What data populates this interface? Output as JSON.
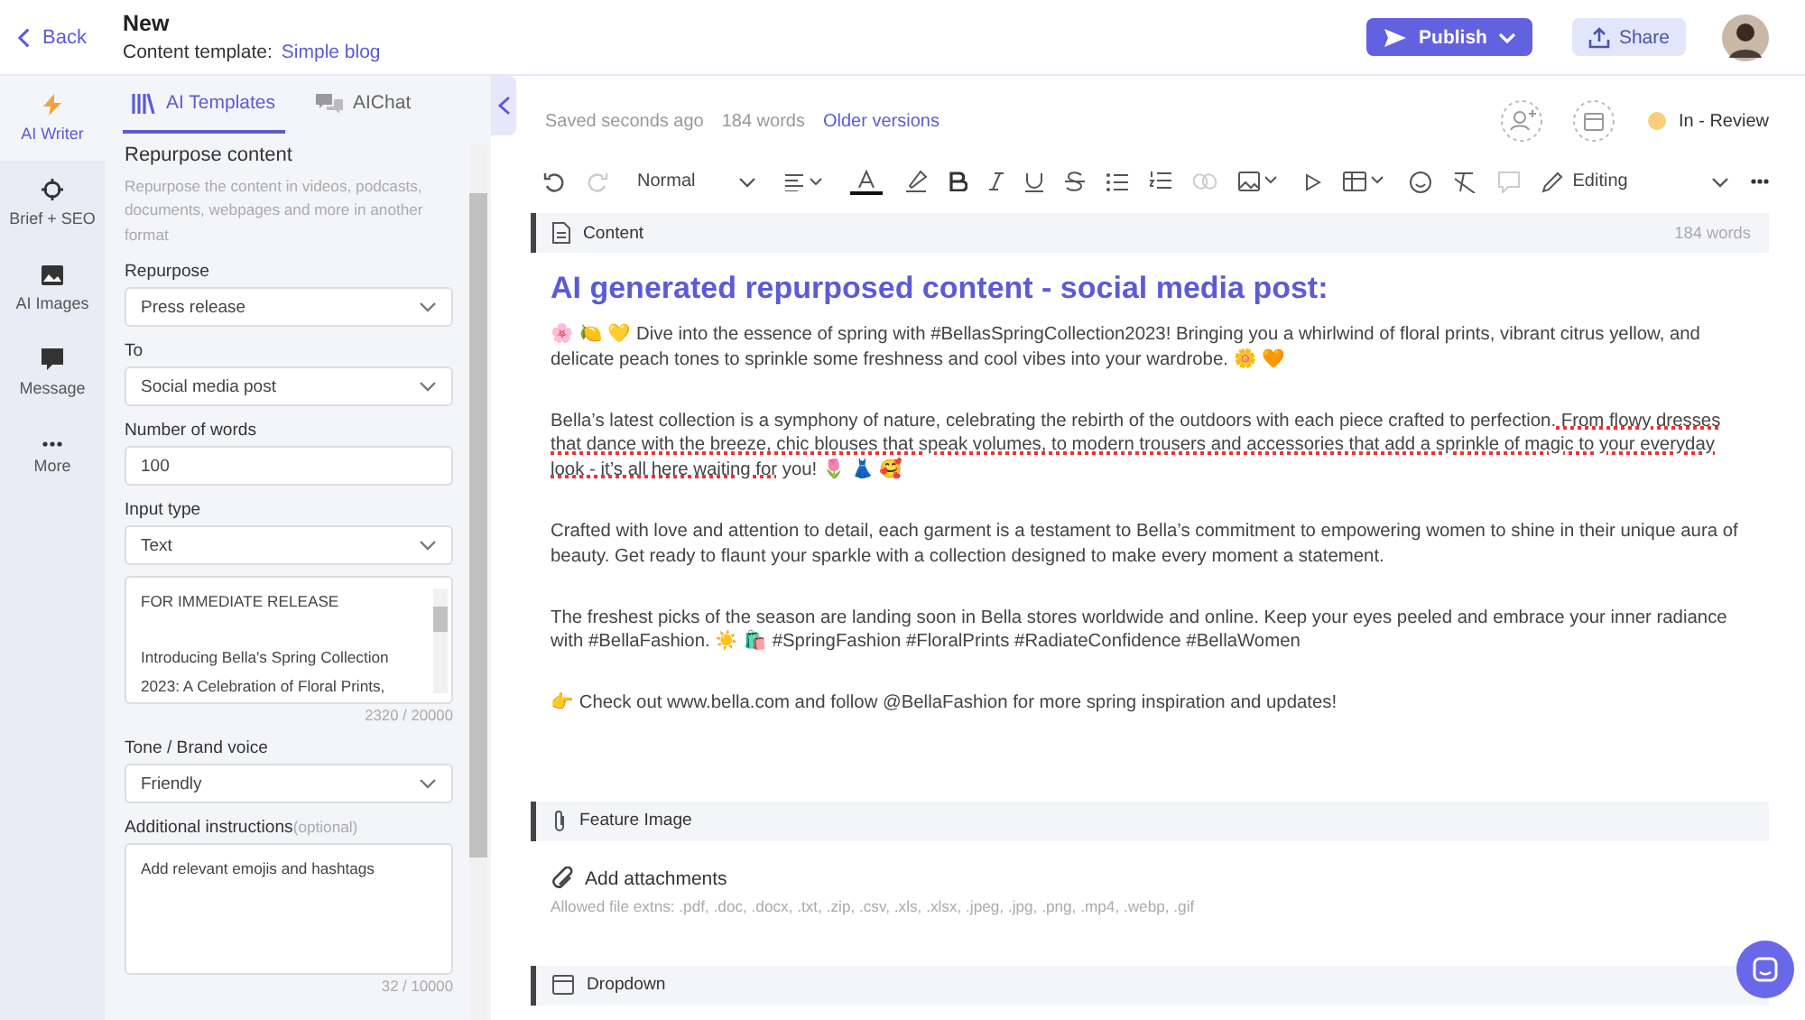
{
  "header": {
    "back": "Back",
    "title": "New",
    "template_label": "Content template:",
    "template_link": "Simple blog",
    "publish": "Publish",
    "share": "Share"
  },
  "rail": [
    {
      "label": "AI Writer",
      "selected": true
    },
    {
      "label": "Brief + SEO",
      "selected": false
    },
    {
      "label": "AI Images",
      "selected": false
    },
    {
      "label": "Message",
      "selected": false
    },
    {
      "label": "More",
      "selected": false
    }
  ],
  "panel_tabs": [
    {
      "label": "AI Templates",
      "selected": true
    },
    {
      "label": "AIChat",
      "selected": false
    }
  ],
  "form": {
    "heading": "Repurpose content",
    "description": "Repurpose the content in videos, podcasts, documents, webpages and more in another format",
    "fields": [
      {
        "kind": "select",
        "label": "Repurpose",
        "value": "Press release"
      },
      {
        "kind": "select",
        "label": "To",
        "value": "Social media post"
      },
      {
        "kind": "input",
        "label": "Number of words",
        "value": "100"
      },
      {
        "kind": "select",
        "label": "Input type",
        "value": "Text"
      },
      {
        "kind": "textarea",
        "lines": [
          "FOR IMMEDIATE RELEASE",
          "Introducing Bella's Spring Collection 2023: A Celebration of Floral Prints,"
        ],
        "counter": "2320 / 20000"
      },
      {
        "kind": "select",
        "label": "Tone / Brand voice",
        "value": "Friendly"
      },
      {
        "kind": "textarea",
        "label": "Additional instructions",
        "hint": "(optional)",
        "lines": [
          "Add relevant emojis and hashtags"
        ],
        "counter": "32 / 10000"
      }
    ]
  },
  "status": {
    "saved": "Saved seconds ago",
    "words": "184 words",
    "older_versions": "Older versions",
    "state": "In - Review",
    "color": "#f9cf7c"
  },
  "toolbar": {
    "style": "Normal",
    "mode": "Editing"
  },
  "content": {
    "title": "Content",
    "count": "184 words",
    "heading": "AI generated repurposed content - social media post:",
    "paragraphs": [
      [
        {
          "text": "🌸 🍋 💛 Dive into the essence of spring with #BellasSpringCollection2023! Bringing you a whirlwind of floral prints, vibrant citrus yellow, and delicate peach tones to sprinkle some freshness and cool vibes into your wardrobe. 🌼 🧡",
          "flagged": false
        }
      ],
      [
        {
          "text": "Bella’s latest collection is a symphony of nature, celebrating the rebirth of the outdoors with each piece crafted to perfection.",
          "flagged": false
        },
        {
          "text": " From flowy dresses that dance with the breeze, chic blouses that speak volumes, to modern trousers and accessories that add a sprinkle of magic to your everyday look - it’s all here waiting for",
          "flagged": true
        },
        {
          "text": " you! 🌷 👗 🥰",
          "flagged": false
        }
      ],
      [
        {
          "text": "Crafted with love and attention to detail, each garment is a testament to Bella’s commitment to empowering women to shine in their unique aura of beauty. Get ready to flaunt your sparkle with a collection designed to make every moment a statement.",
          "flagged": false
        }
      ],
      [
        {
          "text": "The freshest picks of the season are landing soon in Bella stores worldwide and online. Keep your eyes peeled and embrace your inner radiance with #BellaFashion. ☀️ 🛍️ #SpringFashion #FloralPrints #RadiateConfidence #BellaWomen",
          "flagged": false
        }
      ],
      [
        {
          "text": "👉 Check out www.bella.com and follow @BellaFashion for more spring inspiration and updates!",
          "flagged": false
        }
      ]
    ]
  },
  "feature": {
    "title": "Feature Image",
    "add": "Add attachments",
    "allowed": "Allowed file extns: .pdf, .doc, .docx, .txt, .zip, .csv, .xls, .xlsx, .jpeg, .jpg, .png, .mp4, .webp, .gif"
  },
  "next_section": {
    "title": "Dropdown"
  }
}
